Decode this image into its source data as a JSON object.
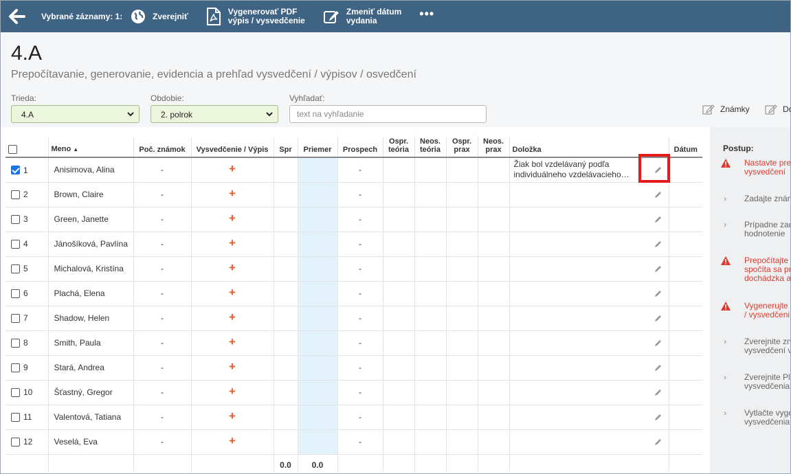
{
  "topbar": {
    "selected_label": "Vybrané záznamy: 1:",
    "publish_label": "Zverejniť",
    "generate_pdf_line1": "Vygenerovať PDF",
    "generate_pdf_line2": "výpis / vysvedčenie",
    "change_date_line1": "Zmeniť dátum",
    "change_date_line2": "vydania",
    "more_label": "•••"
  },
  "header": {
    "class_name": "4.A",
    "subtitle": "Prepočítavanie, generovanie, evidencia a prehľad vysvedčení / výpisov / osvedčení",
    "class_filter_label": "Trieda:",
    "class_filter_value": "4.A",
    "period_filter_label": "Obdobie:",
    "period_filter_value": "2. polrok",
    "search_label": "Vyhľadať:",
    "search_placeholder": "text na vyhľadanie",
    "grades_link": "Známky",
    "second_link": "Do"
  },
  "table": {
    "columns": {
      "name": "Meno",
      "grade_count": "Poč. známok",
      "certificate": "Vysvedčenie / Výpis",
      "spr": "Spr",
      "average": "Priemer",
      "progress": "Prospech",
      "excused_theory_1": "Ospr.",
      "excused_theory_2": "teória",
      "unexcused_theory_1": "Neos.",
      "unexcused_theory_2": "teória",
      "excused_practice_1": "Ospr.",
      "excused_practice_2": "prax",
      "unexcused_practice_1": "Neos.",
      "unexcused_practice_2": "prax",
      "clause": "Doložka",
      "date": "Dátum"
    },
    "rows": [
      {
        "num": "1",
        "name": "Anisimova, Alina",
        "grades": "-",
        "progress": "-",
        "clause_1": "Žiak bol vzdelávaný podľa",
        "clause_2": "individuálneho vzdelávacieho…"
      },
      {
        "num": "2",
        "name": "Brown, Claire",
        "grades": "-",
        "progress": "-"
      },
      {
        "num": "3",
        "name": "Green, Janette",
        "grades": "-",
        "progress": "-"
      },
      {
        "num": "4",
        "name": "Jánošíková, Pavlína",
        "grades": "-",
        "progress": "-"
      },
      {
        "num": "5",
        "name": "Michalová, Kristína",
        "grades": "-",
        "progress": "-"
      },
      {
        "num": "6",
        "name": "Plachá, Elena",
        "grades": "-",
        "progress": "-"
      },
      {
        "num": "7",
        "name": "Shadow, Helen",
        "grades": "-",
        "progress": "-"
      },
      {
        "num": "8",
        "name": "Smith, Paula",
        "grades": "-",
        "progress": "-"
      },
      {
        "num": "9",
        "name": "Stará, Andrea",
        "grades": "-",
        "progress": "-"
      },
      {
        "num": "10",
        "name": "Šťastný, Gregor",
        "grades": "-",
        "progress": "-"
      },
      {
        "num": "11",
        "name": "Valentová, Tatiana",
        "grades": "-",
        "progress": "-"
      },
      {
        "num": "12",
        "name": "Veselá, Eva",
        "grades": "-",
        "progress": "-"
      }
    ],
    "footer": {
      "spr_total": "0.0",
      "average_total": "0.0"
    }
  },
  "panel": {
    "title": "Postup:",
    "steps": [
      {
        "l1": "Nastavte pre",
        "l2": "vysvedčení"
      },
      {
        "l1": "Zadajte znár",
        "l2": ""
      },
      {
        "l1": "Prípadne zad",
        "l2": "hodnotenie"
      },
      {
        "l1": "Prepočítajte",
        "l2": "spočíta sa pr",
        "l3": "dochádzka a"
      },
      {
        "l1": "Vygenerujte",
        "l2": "/ vysvedčeni"
      },
      {
        "l1": "Zverejnite zn",
        "l2": "vysvedčení v"
      },
      {
        "l1": "Zverejnite Pl",
        "l2": "vysvedčenia"
      },
      {
        "l1": "Vytlačte vyge",
        "l2": "vysvedčenia"
      }
    ]
  },
  "colors": {
    "topbar": "#3f6483",
    "warning": "#e03a2e",
    "plus": "#ee5c2a",
    "highlight": "#e51b1b",
    "average_column": "#e4f3fb"
  }
}
